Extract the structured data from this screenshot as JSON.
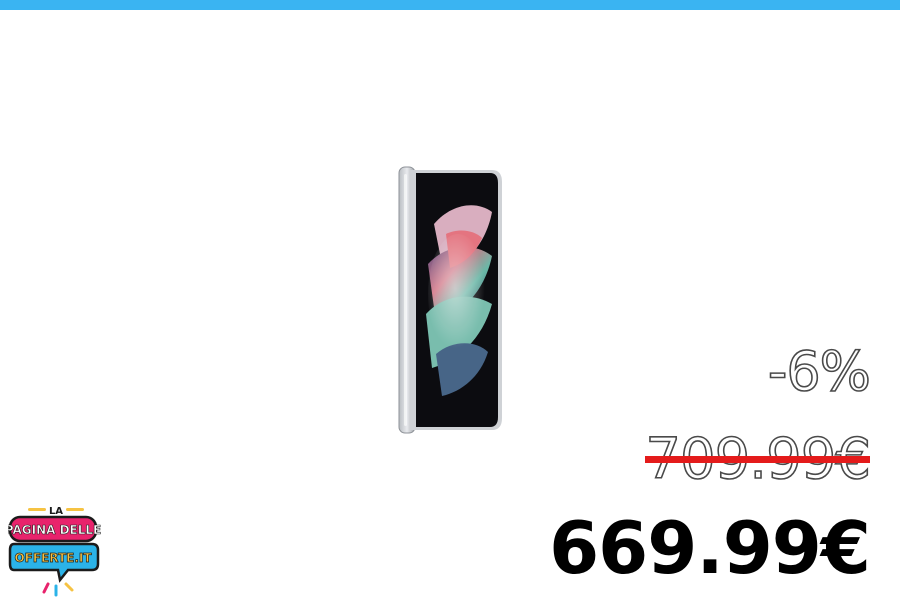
{
  "colors": {
    "top_bar": "#3ab4f2",
    "strike": "#e41b1b",
    "new_price": "#000000",
    "logo_pink": "#e8236c",
    "logo_blue": "#2bb3e8",
    "logo_yellow": "#f6c343",
    "logo_dark": "#1b1b1b"
  },
  "product": {
    "image": "foldable-smartphone-image"
  },
  "pricing": {
    "discount": "-6%",
    "old_price": "709.99€",
    "new_price": "669.99€"
  },
  "logo": {
    "line1": "LA",
    "line2": "PAGINA DELLE",
    "line3": "OFFERTE.IT"
  }
}
